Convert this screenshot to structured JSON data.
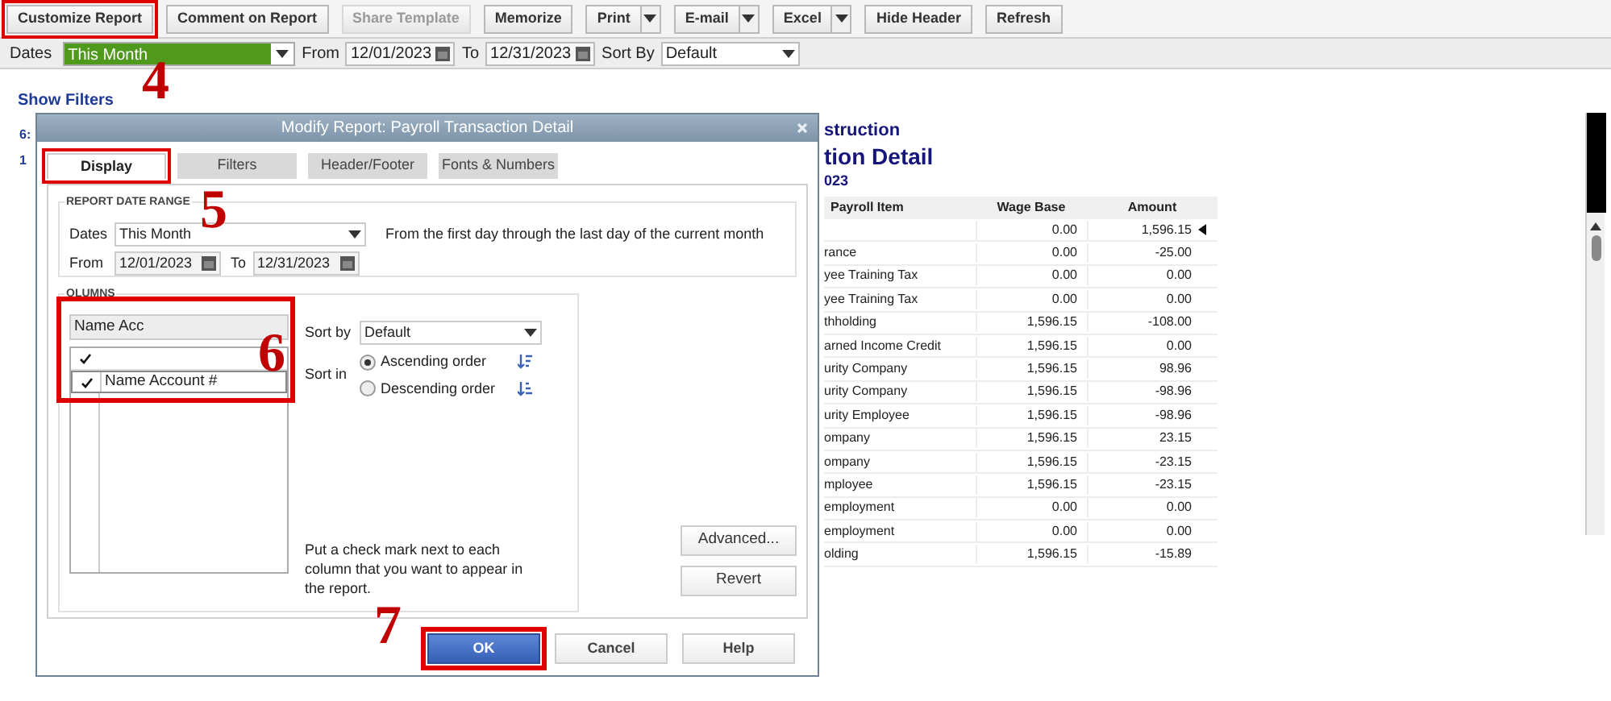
{
  "toolbar": {
    "buttons": [
      {
        "label": "Customize Report",
        "kind": "button",
        "disabled": false,
        "highlighted": true
      },
      {
        "label": "Comment on Report",
        "kind": "button",
        "disabled": false,
        "highlighted": false
      },
      {
        "label": "Share Template",
        "kind": "button",
        "disabled": true,
        "highlighted": false
      },
      {
        "label": "Memorize",
        "kind": "button",
        "disabled": false,
        "highlighted": false
      },
      {
        "label": "Print",
        "kind": "split",
        "disabled": false,
        "highlighted": false
      },
      {
        "label": "E-mail",
        "kind": "split",
        "disabled": false,
        "highlighted": false
      },
      {
        "label": "Excel",
        "kind": "split",
        "disabled": false,
        "highlighted": false
      },
      {
        "label": "Hide Header",
        "kind": "button",
        "disabled": false,
        "highlighted": false
      },
      {
        "label": "Refresh",
        "kind": "button",
        "disabled": false,
        "highlighted": false
      }
    ]
  },
  "filter_bar": {
    "dates_label": "Dates",
    "dates_value": "This Month",
    "from_label": "From",
    "from_value": "12/01/2023",
    "to_label": "To",
    "to_value": "12/31/2023",
    "sort_by_label": "Sort By",
    "sort_by_value": "Default"
  },
  "show_filters": "Show Filters",
  "report": {
    "left_fragments": [
      "6:",
      "1"
    ],
    "title_lines": [
      "struction",
      "tion Detail",
      "023"
    ],
    "table": {
      "columns": [
        "Payroll Item",
        "Wage Base",
        "Amount"
      ],
      "rows": [
        {
          "payroll_item": "",
          "wage_base": "0.00",
          "amount": "1,596.15",
          "marked": true
        },
        {
          "payroll_item": "rance",
          "wage_base": "0.00",
          "amount": "-25.00",
          "marked": false
        },
        {
          "payroll_item": "yee Training Tax",
          "wage_base": "0.00",
          "amount": "0.00",
          "marked": false
        },
        {
          "payroll_item": "yee Training Tax",
          "wage_base": "0.00",
          "amount": "0.00",
          "marked": false
        },
        {
          "payroll_item": "thholding",
          "wage_base": "1,596.15",
          "amount": "-108.00",
          "marked": false
        },
        {
          "payroll_item": "arned Income Credit",
          "wage_base": "1,596.15",
          "amount": "0.00",
          "marked": false
        },
        {
          "payroll_item": "urity Company",
          "wage_base": "1,596.15",
          "amount": "98.96",
          "marked": false
        },
        {
          "payroll_item": "urity Company",
          "wage_base": "1,596.15",
          "amount": "-98.96",
          "marked": false
        },
        {
          "payroll_item": "urity Employee",
          "wage_base": "1,596.15",
          "amount": "-98.96",
          "marked": false
        },
        {
          "payroll_item": "ompany",
          "wage_base": "1,596.15",
          "amount": "23.15",
          "marked": false
        },
        {
          "payroll_item": "ompany",
          "wage_base": "1,596.15",
          "amount": "-23.15",
          "marked": false
        },
        {
          "payroll_item": "mployee",
          "wage_base": "1,596.15",
          "amount": "-23.15",
          "marked": false
        },
        {
          "payroll_item": "employment",
          "wage_base": "0.00",
          "amount": "0.00",
          "marked": false
        },
        {
          "payroll_item": "employment",
          "wage_base": "0.00",
          "amount": "0.00",
          "marked": false
        },
        {
          "payroll_item": "olding",
          "wage_base": "1,596.15",
          "amount": "-15.89",
          "marked": false
        }
      ]
    }
  },
  "dialog": {
    "title": "Modify Report: Payroll Transaction Detail",
    "tabs": [
      {
        "label": "Display",
        "selected": true,
        "highlighted": true
      },
      {
        "label": "Filters",
        "selected": false,
        "highlighted": false
      },
      {
        "label": "Header/Footer",
        "selected": false,
        "highlighted": false
      },
      {
        "label": "Fonts & Numbers",
        "selected": false,
        "highlighted": false
      }
    ],
    "date_range": {
      "heading": "REPORT DATE RANGE",
      "dates_label": "Dates",
      "dates_value": "This Month",
      "description": "From the first day through the last day of the current month",
      "from_label": "From",
      "from_value": "12/01/2023",
      "to_label": "To",
      "to_value": "12/31/2023"
    },
    "columns": {
      "heading": "OLUMNS",
      "search_value": "Name Acc",
      "highlighted": true,
      "items": [
        {
          "name": "Name Account #",
          "checked": true
        }
      ]
    },
    "sort_by_label": "Sort by",
    "sort_by_value": "Default",
    "sort_in_label": "Sort in",
    "sort_orders": [
      {
        "label": "Ascending order",
        "selected": true
      },
      {
        "label": "Descending order",
        "selected": false
      }
    ],
    "hint": "Put a check mark next to each column that you want to appear in the report.",
    "side_buttons": [
      "Advanced...",
      "Revert"
    ],
    "footer_buttons": [
      {
        "label": "OK",
        "primary": true,
        "highlighted": true
      },
      {
        "label": "Cancel",
        "primary": false,
        "highlighted": false
      },
      {
        "label": "Help",
        "primary": false,
        "highlighted": false
      }
    ]
  },
  "annotations": [
    {
      "label": "4"
    },
    {
      "label": "5"
    },
    {
      "label": "6"
    },
    {
      "label": "7"
    }
  ]
}
